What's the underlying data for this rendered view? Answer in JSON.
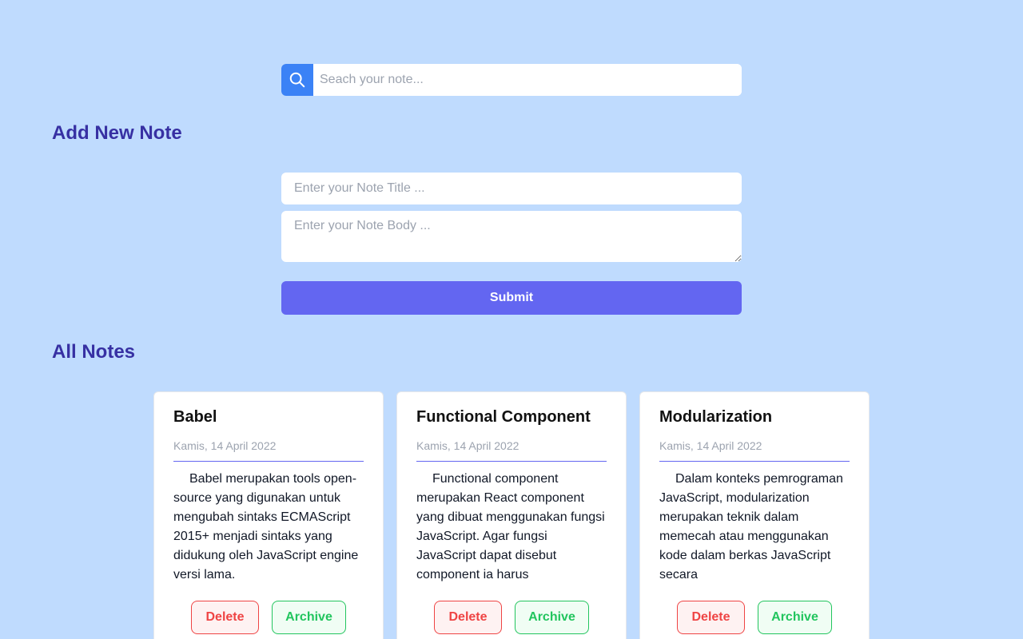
{
  "search": {
    "placeholder": "Seach your note..."
  },
  "add_section": {
    "heading": "Add New Note",
    "title_placeholder": "Enter your Note Title ...",
    "body_placeholder": "Enter your Note Body ...",
    "submit_label": "Submit"
  },
  "notes_section": {
    "heading": "All Notes"
  },
  "notes": [
    {
      "title": "Babel",
      "date": "Kamis, 14 April 2022",
      "body": "Babel merupakan tools open-source yang digunakan untuk mengubah sintaks ECMAScript 2015+ menjadi sintaks yang didukung oleh JavaScript engine versi lama.",
      "delete_label": "Delete",
      "archive_label": "Archive"
    },
    {
      "title": "Functional Component",
      "date": "Kamis, 14 April 2022",
      "body": "Functional component merupakan React component yang dibuat menggunakan fungsi JavaScript. Agar fungsi JavaScript dapat disebut component ia harus",
      "delete_label": "Delete",
      "archive_label": "Archive"
    },
    {
      "title": "Modularization",
      "date": "Kamis, 14 April 2022",
      "body": "Dalam konteks pemrograman JavaScript, modularization merupakan teknik dalam memecah atau menggunakan kode dalam berkas JavaScript secara",
      "delete_label": "Delete",
      "archive_label": "Archive"
    }
  ],
  "colors": {
    "background": "#bfdbfe",
    "heading": "#3730a3",
    "search_button": "#3b82f6",
    "submit": "#6366f1",
    "delete": "#ef4444",
    "archive": "#22c55e"
  },
  "icons": {
    "search": "search-icon"
  }
}
